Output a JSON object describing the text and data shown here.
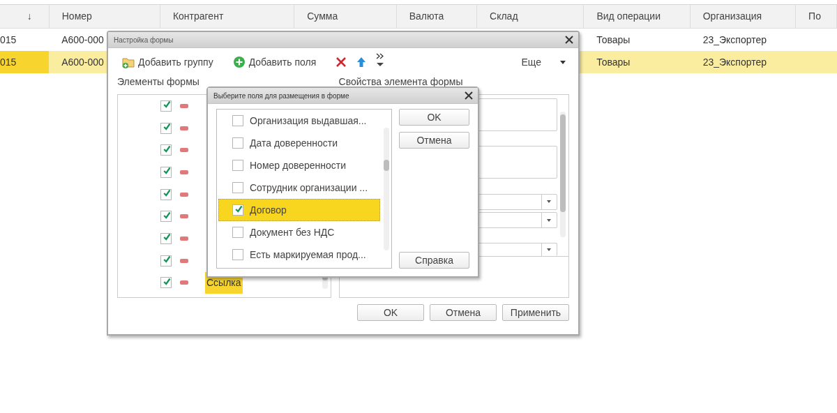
{
  "table": {
    "columns": [
      {
        "label": "↓"
      },
      {
        "label": "Номер"
      },
      {
        "label": "Контрагент"
      },
      {
        "label": "Сумма"
      },
      {
        "label": "Валюта"
      },
      {
        "label": "Склад"
      },
      {
        "label": "Вид операции"
      },
      {
        "label": "Организация"
      },
      {
        "label": "По"
      }
    ],
    "rows": [
      {
        "selected": false,
        "date": "015",
        "number": "А600-000",
        "operation": "Товары",
        "organization": "23_Экспортер"
      },
      {
        "selected": true,
        "date": "015",
        "number": "А600-000",
        "operation": "Товары",
        "organization": "23_Экспортер"
      }
    ]
  },
  "form_settings": {
    "title": "Настройка формы",
    "toolbar": [
      {
        "kind": "add-group",
        "label": "Добавить группу"
      },
      {
        "kind": "add-field",
        "label": "Добавить поля"
      },
      {
        "kind": "delete"
      },
      {
        "kind": "up"
      },
      {
        "kind": "overflow"
      }
    ],
    "more": "Еще",
    "elements_label": "Элементы формы",
    "properties_label": "Свойства элемента формы",
    "tree": [
      {
        "checked": true
      },
      {
        "checked": true
      },
      {
        "checked": true
      },
      {
        "checked": true
      },
      {
        "checked": true
      },
      {
        "checked": true
      },
      {
        "checked": true
      },
      {
        "checked": true
      },
      {
        "checked": true,
        "selected": true,
        "label": "Ссылка"
      }
    ],
    "buttons": [
      "OK",
      "Отмена",
      "Применить"
    ]
  },
  "field_picker": {
    "title": "Выберите поля для размещения в форме",
    "fields": [
      {
        "label": "Организация выдавшая...",
        "checked": false,
        "selected": false
      },
      {
        "label": "Дата доверенности",
        "checked": false,
        "selected": false
      },
      {
        "label": "Номер доверенности",
        "checked": false,
        "selected": false
      },
      {
        "label": "Сотрудник организации ...",
        "checked": false,
        "selected": false
      },
      {
        "label": "Договор",
        "checked": true,
        "selected": true
      },
      {
        "label": "Документ без НДС",
        "checked": false,
        "selected": false
      },
      {
        "label": "Есть маркируемая прод...",
        "checked": false,
        "selected": false
      }
    ],
    "buttons": [
      {
        "kind": "top",
        "label": "OK"
      },
      {
        "kind": "top",
        "label": "Отмена"
      },
      {
        "kind": "bottom",
        "label": "Справка"
      }
    ]
  }
}
